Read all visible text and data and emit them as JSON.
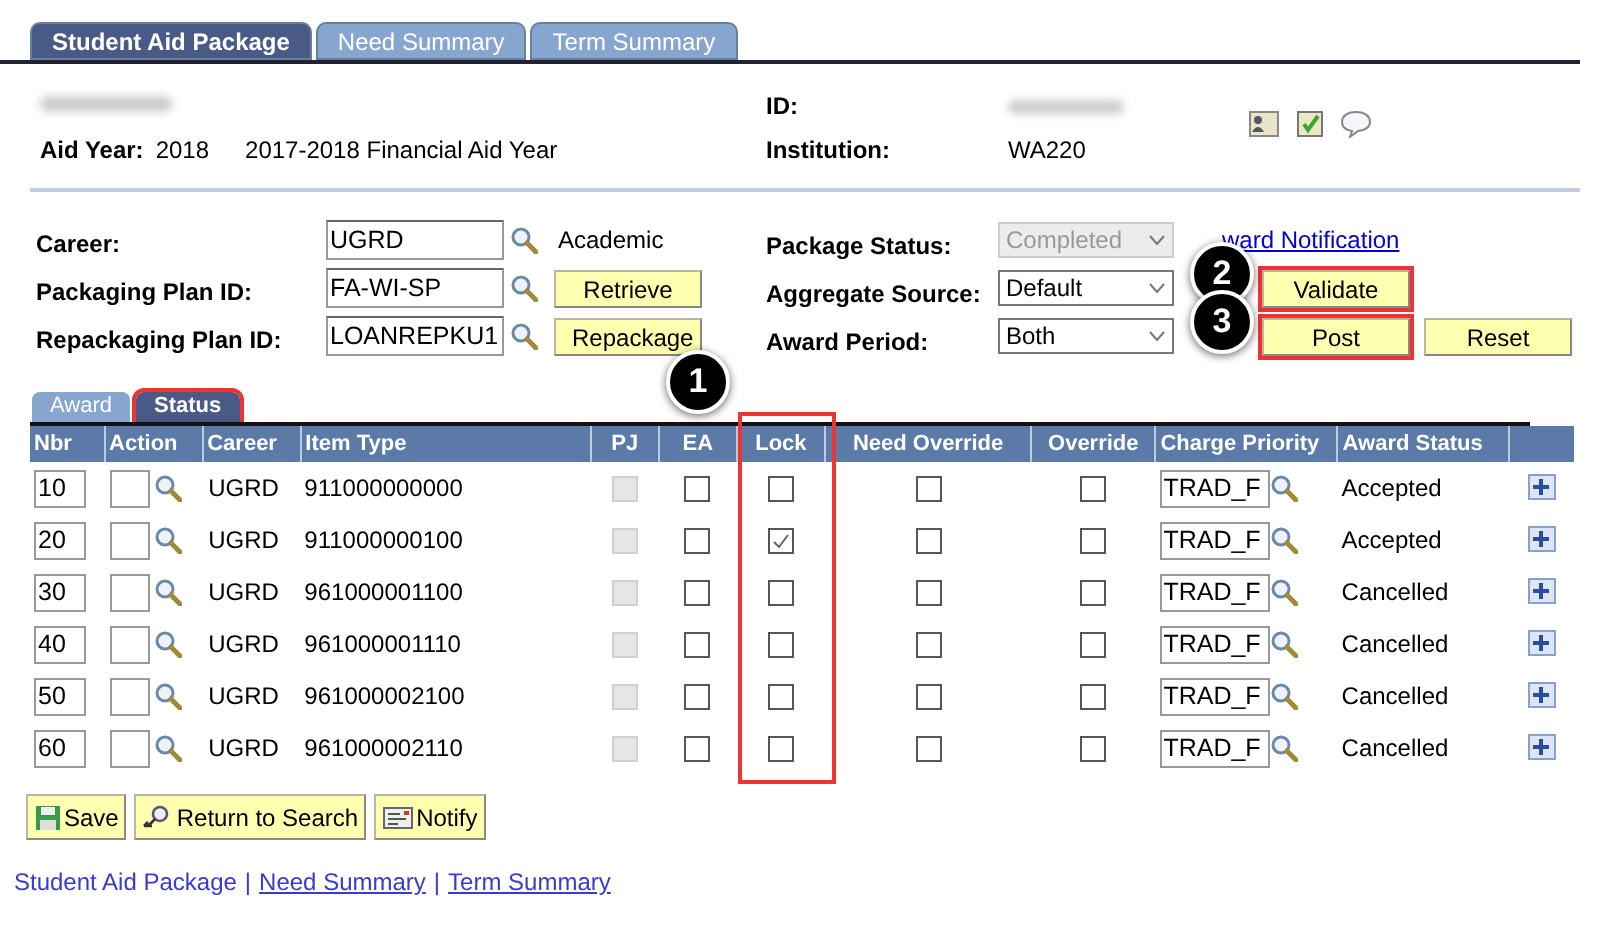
{
  "page_tabs": [
    {
      "label": "Student Aid Package",
      "selected": true
    },
    {
      "label": "Need Summary",
      "selected": false
    },
    {
      "label": "Term Summary",
      "selected": false
    }
  ],
  "header": {
    "aid_year_label": "Aid Year:",
    "aid_year": "2018",
    "aid_year_desc": "2017-2018 Financial Aid Year",
    "id_label": "ID:",
    "institution_label": "Institution:",
    "institution": "WA220"
  },
  "left_fields": [
    {
      "label": "Career:",
      "value": "UGRD",
      "kind": "text",
      "extra": "Academic"
    },
    {
      "label": "Packaging Plan ID:",
      "value": "FA-WI-SP",
      "kind": "button",
      "extra": "Retrieve"
    },
    {
      "label": "Repackaging Plan ID:",
      "value": "LOANREPKU1",
      "kind": "button",
      "extra": "Repackage"
    }
  ],
  "right_fields": [
    {
      "label": "Package Status:",
      "value": "Completed",
      "disabled": true
    },
    {
      "label": "Aggregate Source:",
      "value": "Default",
      "disabled": false
    },
    {
      "label": "Award Period:",
      "value": "Both",
      "disabled": false
    }
  ],
  "award_notification_link": "ward Notification",
  "action_buttons": [
    {
      "label": "Validate",
      "highlighted": true,
      "callout": "2"
    },
    {
      "label": "Post",
      "highlighted": true,
      "callout": "3"
    },
    {
      "label": "Reset",
      "highlighted": false
    }
  ],
  "grid_tabs": [
    {
      "label": "Award",
      "selected": false,
      "highlighted": false
    },
    {
      "label": "Status",
      "selected": true,
      "highlighted": true
    }
  ],
  "table": {
    "columns": [
      "Nbr",
      "Action",
      "Career",
      "Item Type",
      "PJ",
      "EA",
      "Lock",
      "Need Override",
      "Override",
      "Charge Priority",
      "Award Status"
    ],
    "lock_callout": "1",
    "rows": [
      {
        "nbr": "10",
        "career": "UGRD",
        "item_type": "911000000000",
        "pj": {
          "checked": false,
          "disabled": true
        },
        "ea": false,
        "lock": false,
        "need_override": false,
        "override": false,
        "charge_priority": "TRAD_F",
        "award_status": "Accepted"
      },
      {
        "nbr": "20",
        "career": "UGRD",
        "item_type": "911000000100",
        "pj": {
          "checked": false,
          "disabled": true
        },
        "ea": false,
        "lock": true,
        "need_override": false,
        "override": false,
        "charge_priority": "TRAD_F",
        "award_status": "Accepted"
      },
      {
        "nbr": "30",
        "career": "UGRD",
        "item_type": "961000001100",
        "pj": {
          "checked": false,
          "disabled": true
        },
        "ea": false,
        "lock": false,
        "need_override": false,
        "override": false,
        "charge_priority": "TRAD_F",
        "award_status": "Cancelled"
      },
      {
        "nbr": "40",
        "career": "UGRD",
        "item_type": "961000001110",
        "pj": {
          "checked": false,
          "disabled": true
        },
        "ea": false,
        "lock": false,
        "need_override": false,
        "override": false,
        "charge_priority": "TRAD_F",
        "award_status": "Cancelled"
      },
      {
        "nbr": "50",
        "career": "UGRD",
        "item_type": "961000002100",
        "pj": {
          "checked": false,
          "disabled": true
        },
        "ea": false,
        "lock": false,
        "need_override": false,
        "override": false,
        "charge_priority": "TRAD_F",
        "award_status": "Cancelled"
      },
      {
        "nbr": "60",
        "career": "UGRD",
        "item_type": "961000002110",
        "pj": {
          "checked": false,
          "disabled": true
        },
        "ea": false,
        "lock": false,
        "need_override": false,
        "override": false,
        "charge_priority": "TRAD_F",
        "award_status": "Cancelled"
      }
    ]
  },
  "toolbar": [
    {
      "label": "Save",
      "kind": "save"
    },
    {
      "label": "Return to Search",
      "kind": "search"
    },
    {
      "label": "Notify",
      "kind": "notify"
    }
  ],
  "footer_separator": "|",
  "footer_links": [
    {
      "label": "Student Aid Package",
      "link": false
    },
    {
      "label": "Need Summary",
      "link": true
    },
    {
      "label": "Term Summary",
      "link": true
    }
  ]
}
